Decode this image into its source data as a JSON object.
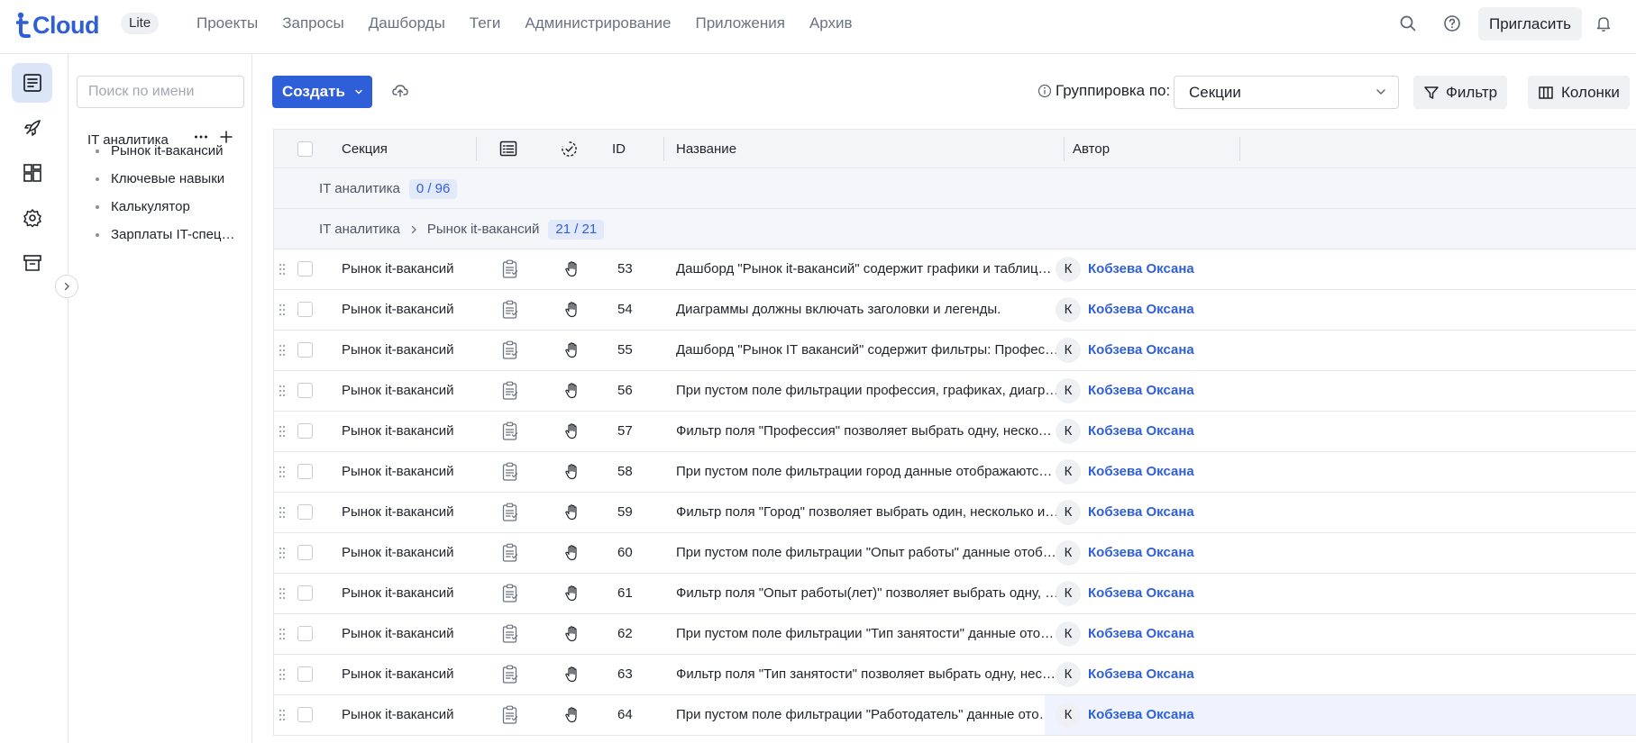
{
  "app": {
    "logo_text": "Cloud",
    "edition_badge": "Lite"
  },
  "nav": [
    "Проекты",
    "Запросы",
    "Дашборды",
    "Теги",
    "Администрирование",
    "Приложения",
    "Архив"
  ],
  "header": {
    "invite_label": "Пригласить"
  },
  "tree": {
    "search_placeholder": "Поиск по имени",
    "root_label": "IT аналитика",
    "children": [
      "Рынок it-вакансий",
      "Ключевые навыки",
      "Калькулятор",
      "Зарплаты IT-специалистов"
    ]
  },
  "toolbar": {
    "create_label": "Создать",
    "group_by_label": "Группировка по:",
    "group_by_value": "Секции",
    "filter_label": "Фильтр",
    "columns_label": "Колонки"
  },
  "table": {
    "columns": {
      "section": "Секция",
      "id": "ID",
      "title": "Название",
      "author": "Автор"
    },
    "group_root": {
      "label": "IT аналитика",
      "count": "0 / 96"
    },
    "group_sub": {
      "parent": "IT аналитика",
      "label": "Рынок it-вакансий",
      "count": "21 / 21"
    },
    "rows": [
      {
        "section": "Рынок it-вакансий",
        "id": "53",
        "title": "Дашборд \"Рынок it-вакансий\" содержит графики и таблицы: ...",
        "avatar": "К",
        "author": "Кобзева Оксана"
      },
      {
        "section": "Рынок it-вакансий",
        "id": "54",
        "title": "Диаграммы должны включать заголовки и легенды.",
        "avatar": "К",
        "author": "Кобзева Оксана"
      },
      {
        "section": "Рынок it-вакансий",
        "id": "55",
        "title": "Дашборд \"Рынок IT вакансий\" содержит фильтры: Професси...",
        "avatar": "К",
        "author": "Кобзева Оксана"
      },
      {
        "section": "Рынок it-вакансий",
        "id": "56",
        "title": "При пустом поле фильтрации профессия, графиках, диаграм...",
        "avatar": "К",
        "author": "Кобзева Оксана"
      },
      {
        "section": "Рынок it-вакансий",
        "id": "57",
        "title": "Фильтр поля \"Профессия\" позволяет выбрать одну, несколь...",
        "avatar": "К",
        "author": "Кобзева Оксана"
      },
      {
        "section": "Рынок it-вакансий",
        "id": "58",
        "title": "При пустом поле фильтрации город данные отображаются п...",
        "avatar": "К",
        "author": "Кобзева Оксана"
      },
      {
        "section": "Рынок it-вакансий",
        "id": "59",
        "title": "Фильтр поля \"Город\" позволяет выбрать один, несколько ил...",
        "avatar": "К",
        "author": "Кобзева Оксана"
      },
      {
        "section": "Рынок it-вакансий",
        "id": "60",
        "title": "При пустом поле фильтрации \"Опыт работы\" данные отобра...",
        "avatar": "К",
        "author": "Кобзева Оксана"
      },
      {
        "section": "Рынок it-вакансий",
        "id": "61",
        "title": "Фильтр поля \"Опыт работы(лет)\" позволяет выбрать одну, н...",
        "avatar": "К",
        "author": "Кобзева Оксана"
      },
      {
        "section": "Рынок it-вакансий",
        "id": "62",
        "title": "При пустом поле фильтрации \"Тип занятости\" данные отобр...",
        "avatar": "К",
        "author": "Кобзева Оксана"
      },
      {
        "section": "Рынок it-вакансий",
        "id": "63",
        "title": "Фильтр поля \"Тип занятости\" позволяет выбрать одну, неско...",
        "avatar": "К",
        "author": "Кобзева Оксана"
      },
      {
        "section": "Рынок it-вакансий",
        "id": "64",
        "title": "При пустом поле фильтрации \"Работодатель\" данные отобра...",
        "avatar": "К",
        "author": "Кобзева Оксана"
      }
    ]
  },
  "colors": {
    "accent": "#2f5fd8",
    "badge_bg": "#e1e9fb",
    "rail_active": "#dbe5f8"
  },
  "icons": [
    "search-icon",
    "help-icon",
    "bell-icon",
    "test-cases-icon",
    "launches-icon",
    "dashboards-icon",
    "settings-icon",
    "archive-icon",
    "upload-icon",
    "info-icon",
    "filter-icon",
    "columns-icon",
    "checklist-icon",
    "status-icon",
    "manual-hand-icon",
    "drag-handle-icon"
  ]
}
